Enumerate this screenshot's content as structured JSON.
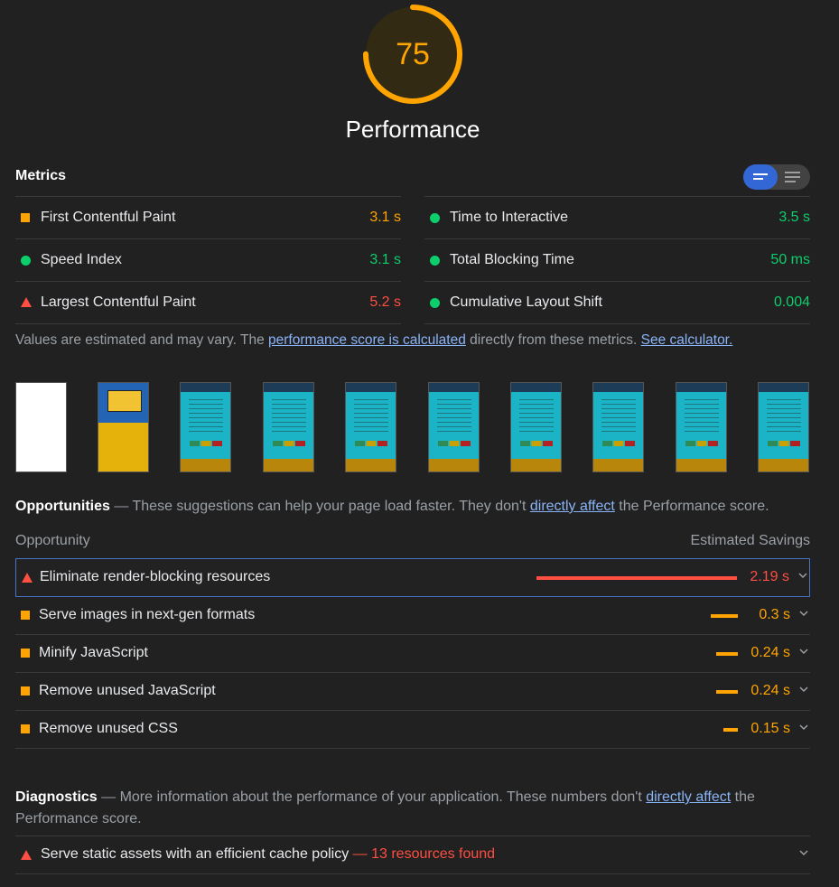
{
  "colors": {
    "average": "#ffa400",
    "pass": "#0cce6b",
    "fail": "#ff4e42",
    "link": "#8ab4f8"
  },
  "score": {
    "value": "75",
    "fraction": 0.75,
    "title": "Performance"
  },
  "metrics": {
    "header": "Metrics",
    "left": [
      {
        "icon": "orange-square-icon",
        "label": "First Contentful Paint",
        "value": "3.1 s",
        "status": "average"
      },
      {
        "icon": "green-circle-icon",
        "label": "Speed Index",
        "value": "3.1 s",
        "status": "pass"
      },
      {
        "icon": "red-triangle-icon",
        "label": "Largest Contentful Paint",
        "value": "5.2 s",
        "status": "fail"
      }
    ],
    "right": [
      {
        "icon": "green-circle-icon",
        "label": "Time to Interactive",
        "value": "3.5 s",
        "status": "pass"
      },
      {
        "icon": "green-circle-icon",
        "label": "Total Blocking Time",
        "value": "50 ms",
        "status": "pass"
      },
      {
        "icon": "green-circle-icon",
        "label": "Cumulative Layout Shift",
        "value": "0.004",
        "status": "pass"
      }
    ],
    "note_prefix": "Values are estimated and may vary. The ",
    "note_link1": "performance score is calculated",
    "note_mid": " directly from these metrics. ",
    "note_link2": "See calculator."
  },
  "filmstrip": [
    "blank-frame",
    "loading-frame",
    "content-frame",
    "content-frame",
    "content-frame",
    "content-frame",
    "content-frame",
    "content-frame",
    "content-frame",
    "content-frame"
  ],
  "opportunities": {
    "title": "Opportunities",
    "desc_prefix": " — These suggestions can help your page load faster. They don't ",
    "desc_link": "directly affect",
    "desc_suffix": " the Performance score.",
    "col_left": "Opportunity",
    "col_right": "Estimated Savings",
    "items": [
      {
        "label": "Eliminate render-blocking resources",
        "value": "2.19 s",
        "savings": 2.19,
        "status": "fail"
      },
      {
        "label": "Serve images in next-gen formats",
        "value": "0.3 s",
        "savings": 0.3,
        "status": "average"
      },
      {
        "label": "Minify JavaScript",
        "value": "0.24 s",
        "savings": 0.24,
        "status": "average"
      },
      {
        "label": "Remove unused JavaScript",
        "value": "0.24 s",
        "savings": 0.24,
        "status": "average"
      },
      {
        "label": "Remove unused CSS",
        "value": "0.15 s",
        "savings": 0.15,
        "status": "average"
      }
    ]
  },
  "diagnostics": {
    "title": "Diagnostics",
    "desc_prefix": " — More information about the performance of your application. These numbers don't ",
    "desc_link": "directly affect",
    "desc_suffix": " the Performance score.",
    "items": [
      {
        "label": "Serve static assets with an efficient cache policy",
        "detail": " — 13 resources found",
        "status": "fail"
      }
    ]
  }
}
